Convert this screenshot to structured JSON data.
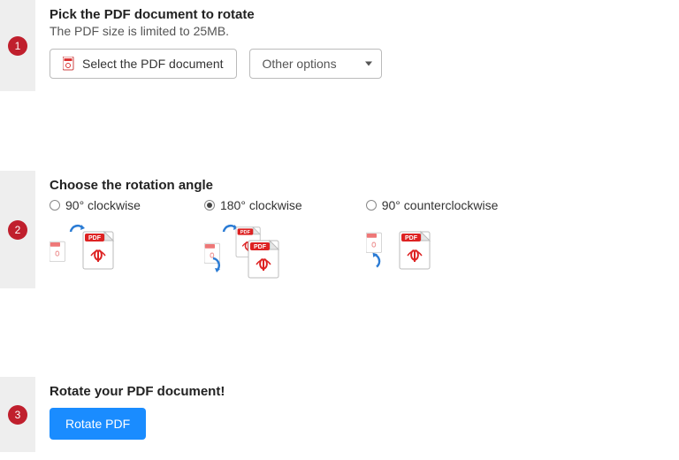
{
  "step1": {
    "num": "1",
    "title": "Pick the PDF document to rotate",
    "subtitle": "The PDF size is limited to 25MB.",
    "select_button": "Select the PDF document",
    "other_options": "Other options"
  },
  "step2": {
    "num": "2",
    "title": "Choose the rotation angle",
    "options": [
      {
        "label": "90° clockwise",
        "selected": false
      },
      {
        "label": "180° clockwise",
        "selected": true
      },
      {
        "label": "90° counterclockwise",
        "selected": false
      }
    ]
  },
  "step3": {
    "num": "3",
    "title": "Rotate your PDF document!",
    "button": "Rotate PDF"
  },
  "colors": {
    "accent_red": "#c01f2d",
    "primary_blue": "#1a8cff"
  }
}
